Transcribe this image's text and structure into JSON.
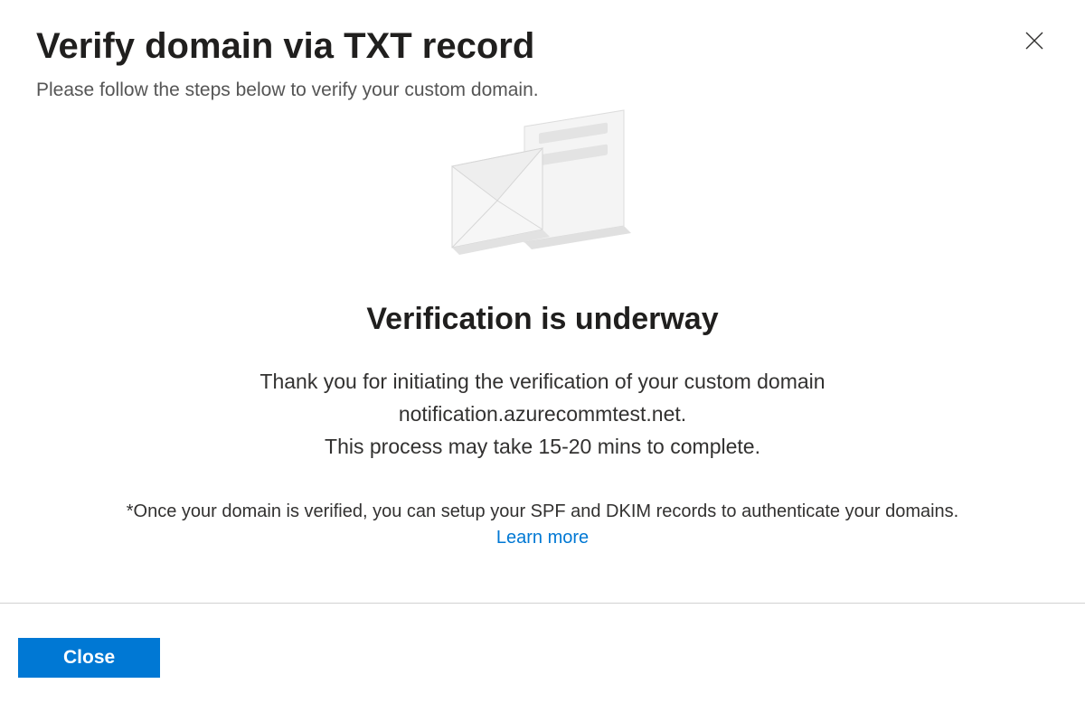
{
  "header": {
    "title": "Verify domain via TXT record",
    "subtitle": "Please follow the steps below to verify your custom domain."
  },
  "content": {
    "status_heading": "Verification is underway",
    "thank_you_line": "Thank you for initiating the verification of your custom domain",
    "domain": "notification.azurecommtest.net.",
    "process_time": "This process may take 15-20 mins to complete.",
    "note": "*Once your domain is verified, you can setup your SPF and DKIM records to authenticate your domains.",
    "learn_more": "Learn more"
  },
  "footer": {
    "close_label": "Close"
  }
}
